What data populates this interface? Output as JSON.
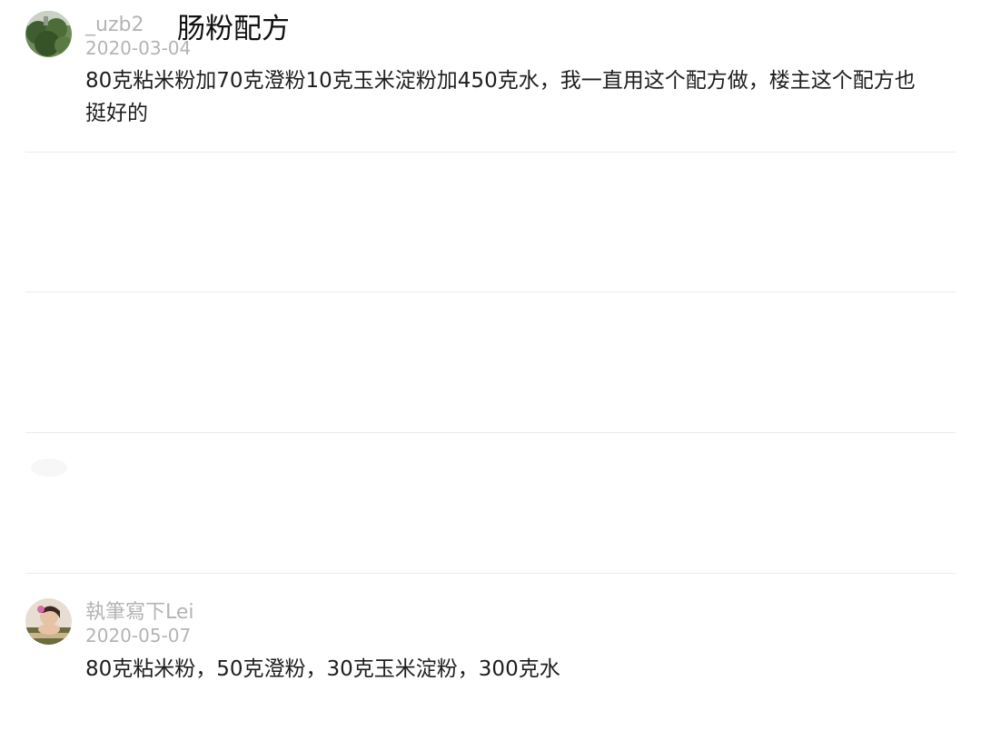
{
  "overlay_title": "肠粉配方",
  "comments": [
    {
      "username": "_uzb2",
      "date": "2020-03-04",
      "text": "80克粘米粉加70克澄粉10克玉米淀粉加450克水，我一直用这个配方做，楼主这个配方也挺好的"
    },
    {
      "username": "執筆寫下Lei",
      "date": "2020-05-07",
      "text": "80克粘米粉，50克澄粉，30克玉米淀粉，300克水"
    }
  ]
}
